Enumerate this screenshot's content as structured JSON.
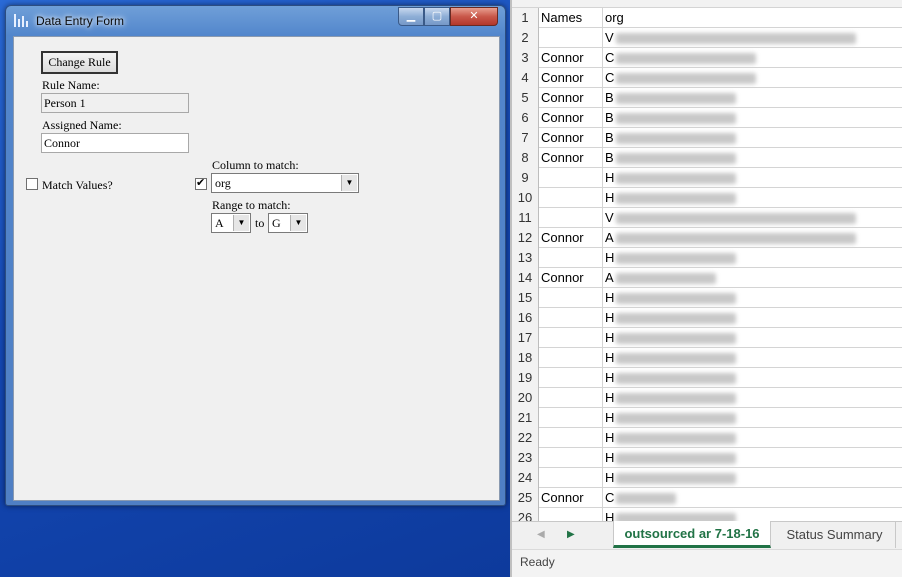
{
  "dialog": {
    "title": "Data Entry Form",
    "buttons": {
      "minimize": "▁",
      "maximize": "▢",
      "close": "✕"
    },
    "change_rule_label": "Change Rule",
    "rule_name_label": "Rule Name:",
    "rule_name_value": "Person 1",
    "assigned_name_label": "Assigned Name:",
    "assigned_name_value": "Connor",
    "match_values_label": "Match Values?",
    "match_values_checked": false,
    "column_checkbox_checked": true,
    "column_to_match_label": "Column to match:",
    "column_to_match_value": "org",
    "range_to_match_label": "Range to match:",
    "range_from": "A",
    "range_to_word": "to",
    "range_to": "G"
  },
  "sheet": {
    "header": {
      "row": "1",
      "a": "Names",
      "b": "org"
    },
    "rows": [
      {
        "row": "2",
        "a": "",
        "b": "V"
      },
      {
        "row": "3",
        "a": "Connor",
        "b": "C"
      },
      {
        "row": "4",
        "a": "Connor",
        "b": "C"
      },
      {
        "row": "5",
        "a": "Connor",
        "b": "B"
      },
      {
        "row": "6",
        "a": "Connor",
        "b": "B"
      },
      {
        "row": "7",
        "a": "Connor",
        "b": "B"
      },
      {
        "row": "8",
        "a": "Connor",
        "b": "B"
      },
      {
        "row": "9",
        "a": "",
        "b": "H"
      },
      {
        "row": "10",
        "a": "",
        "b": "H"
      },
      {
        "row": "11",
        "a": "",
        "b": "V"
      },
      {
        "row": "12",
        "a": "Connor",
        "b": "A"
      },
      {
        "row": "13",
        "a": "",
        "b": "H"
      },
      {
        "row": "14",
        "a": "Connor",
        "b": "A"
      },
      {
        "row": "15",
        "a": "",
        "b": "H"
      },
      {
        "row": "16",
        "a": "",
        "b": "H"
      },
      {
        "row": "17",
        "a": "",
        "b": "H"
      },
      {
        "row": "18",
        "a": "",
        "b": "H"
      },
      {
        "row": "19",
        "a": "",
        "b": "H"
      },
      {
        "row": "20",
        "a": "",
        "b": "H"
      },
      {
        "row": "21",
        "a": "",
        "b": "H"
      },
      {
        "row": "22",
        "a": "",
        "b": "H"
      },
      {
        "row": "23",
        "a": "",
        "b": "H"
      },
      {
        "row": "24",
        "a": "",
        "b": "H"
      },
      {
        "row": "25",
        "a": "Connor",
        "b": "C"
      },
      {
        "row": "26",
        "a": "",
        "b": "H"
      }
    ],
    "tabs": {
      "active": "outsourced ar 7-18-16",
      "other": "Status Summary"
    },
    "status": "Ready"
  },
  "colors": {
    "excel_green": "#217346",
    "window_blue": "#5286cc"
  }
}
